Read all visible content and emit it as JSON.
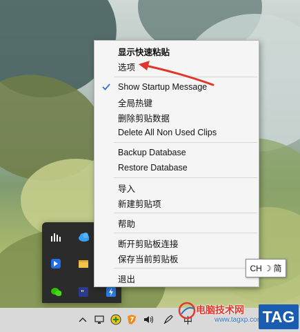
{
  "context_menu": {
    "items": [
      {
        "label": "显示快速粘贴",
        "bold": true
      },
      {
        "label": "选项"
      },
      {
        "label": "Show Startup Message",
        "checked": true
      },
      {
        "label": "全局热键"
      },
      {
        "label": "删除剪贴数据"
      },
      {
        "label": "Delete All Non Used Clips"
      },
      {
        "label": "Backup Database"
      },
      {
        "label": "Restore Database"
      },
      {
        "label": "导入"
      },
      {
        "label": "新建剪贴项"
      },
      {
        "label": "帮助"
      },
      {
        "label": "断开剪贴板连接"
      },
      {
        "label": "保存当前剪贴板"
      },
      {
        "label": "退出"
      }
    ]
  },
  "tray_overflow": {
    "icons": [
      "bar-chart-icon",
      "cloud-icon",
      "blue-app-icon",
      "folder-icon",
      "wechat-icon",
      "quote-app-icon",
      "lightning-icon"
    ]
  },
  "ime_tooltip": {
    "lang": "CH",
    "mode_symbol": "☽",
    "script": "简"
  },
  "taskbar": {
    "chevron": "^",
    "ime_label": "中",
    "icons": [
      "show-hidden-icon",
      "network-icon",
      "plus-app-icon",
      "shield-icon",
      "volume-icon",
      "pen-icon",
      "input-method-icon"
    ]
  },
  "watermark": {
    "site": "电脑技术网",
    "url": "www.tagxp.com",
    "tag": "TAG"
  },
  "colors": {
    "arrow": "#e0352b",
    "menu_bg": "#f5f5f5",
    "check": "#2a6fd6",
    "taskbar": "#d9d9d9",
    "tray_panel": "#2b2b2b",
    "tag_bg": "#1a5cb0"
  }
}
